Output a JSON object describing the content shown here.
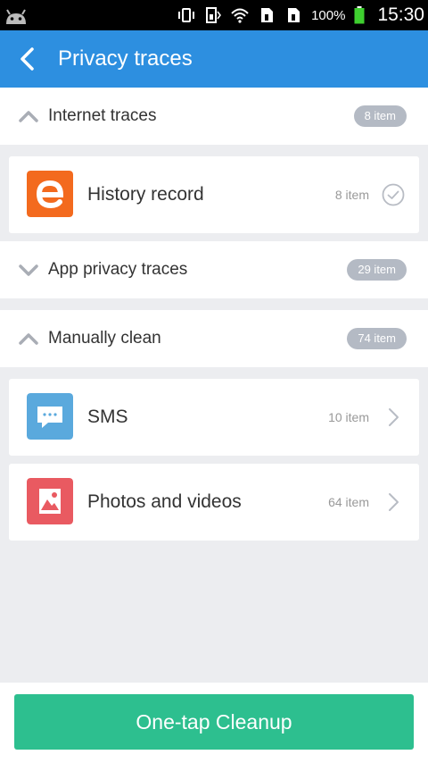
{
  "status_bar": {
    "battery_pct": "100%",
    "time": "15:30",
    "icons": [
      "android-icon",
      "vibrate-icon",
      "sim-data-icon",
      "wifi-icon",
      "sim-card-icon",
      "sim-card-icon",
      "battery-icon"
    ]
  },
  "app_bar": {
    "title": "Privacy traces",
    "back_icon": "back-arrow-icon"
  },
  "sections": [
    {
      "label": "Internet traces",
      "badge": "8 item",
      "expanded": true
    },
    {
      "label": "App privacy traces",
      "badge": "29 item",
      "expanded": false
    },
    {
      "label": "Manually clean",
      "badge": "74 item",
      "expanded": true
    }
  ],
  "items": [
    {
      "name": "History record",
      "count": "8 item",
      "icon": "browser-e-icon",
      "trailing": "check-circle-icon",
      "color": "#f36a1e"
    },
    {
      "name": "SMS",
      "count": "10 item",
      "icon": "message-bubble-icon",
      "trailing": "chevron-right-icon",
      "color": "#5aa9dd"
    },
    {
      "name": "Photos and videos",
      "count": "64 item",
      "icon": "photo-icon",
      "trailing": "chevron-right-icon",
      "color": "#e95a61"
    }
  ],
  "bottom": {
    "cleanup_label": "One-tap Cleanup",
    "accent": "#2dbf8f"
  },
  "colors": {
    "app_bar": "#2d8fe0",
    "background": "#ecedf0",
    "badge": "#b4bac4"
  }
}
